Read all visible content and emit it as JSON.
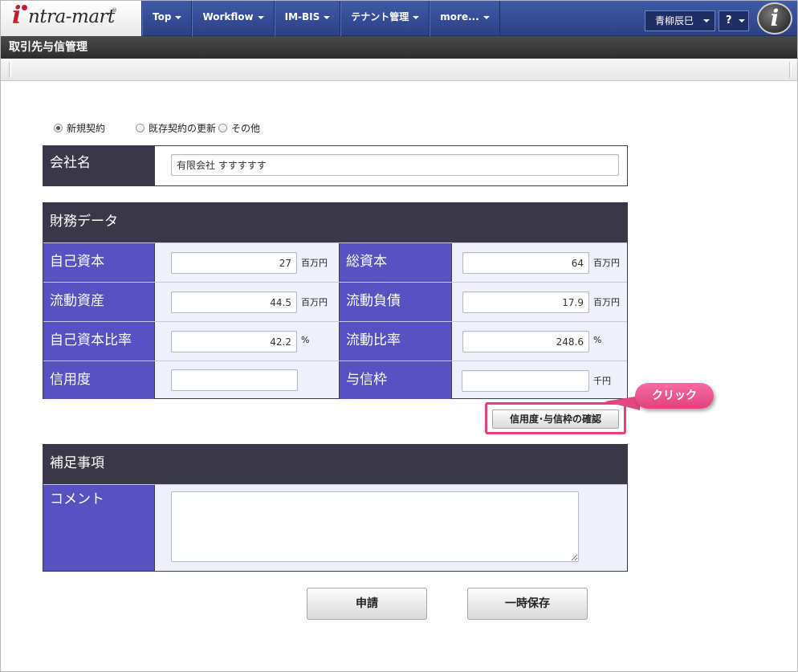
{
  "header": {
    "logo_text": "ntra-mart",
    "logo_i": "i",
    "logo_reg": "®",
    "nav": [
      {
        "label": "Top"
      },
      {
        "label": "Workflow"
      },
      {
        "label": "IM-BIS"
      },
      {
        "label": "テナント管理"
      },
      {
        "label": "more..."
      }
    ],
    "user": "青柳辰巳",
    "help": "?",
    "badge": "i"
  },
  "title": "取引先与信管理",
  "radio_options": [
    {
      "label": "新規契約",
      "checked": true
    },
    {
      "label": "既存契約の更新",
      "checked": false
    },
    {
      "label": "その他",
      "checked": false
    }
  ],
  "company": {
    "label": "会社名",
    "value": "有限会社 すすすすす"
  },
  "finance": {
    "section_title": "財務データ",
    "rows": [
      {
        "left_label": "自己資本",
        "left_value": "27",
        "left_unit": "百万円",
        "right_label": "総資本",
        "right_value": "64",
        "right_unit": "百万円"
      },
      {
        "left_label": "流動資産",
        "left_value": "44.5",
        "left_unit": "百万円",
        "right_label": "流動負債",
        "right_value": "17.9",
        "right_unit": "百万円"
      },
      {
        "left_label": "自己資本比率",
        "left_value": "42.2",
        "left_unit": "%",
        "right_label": "流動比率",
        "right_value": "248.6",
        "right_unit": "%"
      },
      {
        "left_label": "信用度",
        "left_value": "",
        "left_unit": "",
        "right_label": "与信枠",
        "right_value": "",
        "right_unit": "千円"
      }
    ],
    "confirm_button": "信用度･与信枠の確認",
    "callout": "クリック"
  },
  "notes": {
    "section_title": "補足事項",
    "comment_label": "コメント",
    "comment_value": ""
  },
  "actions": {
    "submit": "申請",
    "save_draft": "一時保存"
  },
  "colors": {
    "label_bg": "#5751c1",
    "section_bg": "#3a3848",
    "field_area_bg": "#eef0fb",
    "highlight": "#e5407a"
  }
}
